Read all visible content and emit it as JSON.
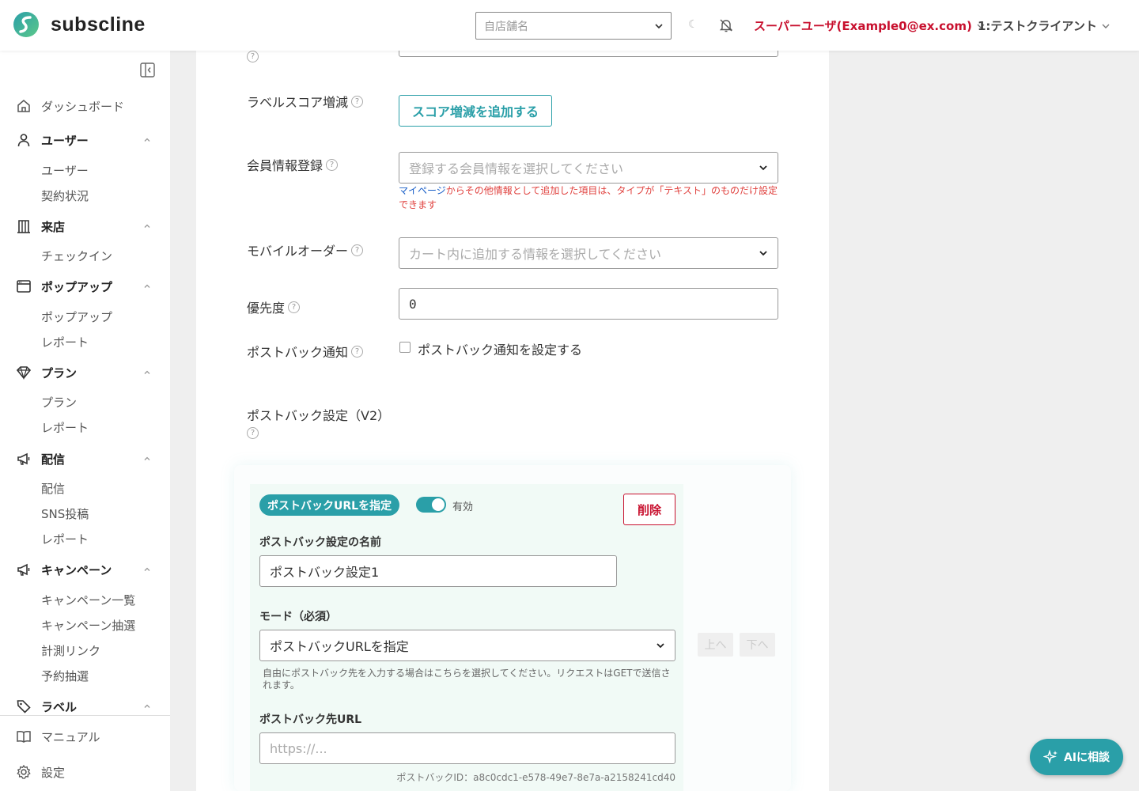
{
  "app": {
    "name": "subscline"
  },
  "header": {
    "store_placeholder": "自店舗名",
    "user": "スーパーユーザ(Example0@ex.com)",
    "client": "1:テストクライアント"
  },
  "sidebar": {
    "items": [
      {
        "label": "ダッシュボード"
      },
      {
        "label": "ユーザー",
        "children": [
          "ユーザー",
          "契約状況"
        ]
      },
      {
        "label": "来店",
        "children": [
          "チェックイン"
        ]
      },
      {
        "label": "ポップアップ",
        "children": [
          "ポップアップ",
          "レポート"
        ]
      },
      {
        "label": "プラン",
        "children": [
          "プラン",
          "レポート"
        ]
      },
      {
        "label": "配信",
        "children": [
          "配信",
          "SNS投稿",
          "レポート"
        ]
      },
      {
        "label": "キャンペーン",
        "children": [
          "キャンペーン一覧",
          "キャンペーン抽選",
          "計測リンク",
          "予約抽選"
        ]
      },
      {
        "label": "ラベル"
      }
    ],
    "bottom": [
      {
        "label": "マニュアル"
      },
      {
        "label": "設定"
      }
    ]
  },
  "form": {
    "label_score": {
      "label": "ラベルスコア増減",
      "button": "スコア増減を追加する"
    },
    "member_info": {
      "label": "会員情報登録",
      "placeholder": "登録する会員情報を選択してください",
      "note_link": "マイページ",
      "note_text": "からその他情報として追加した項目は、タイプが「テキスト」のものだけ設定できます"
    },
    "mobile_order": {
      "label": "モバイルオーダー",
      "placeholder": "カート内に追加する情報を選択してください"
    },
    "priority": {
      "label": "優先度",
      "value": "0"
    },
    "postback_notify": {
      "label": "ポストバック通知",
      "checkbox_label": "ポストバック通知を設定する"
    },
    "postback_v2": {
      "label": "ポストバック設定（V2）"
    }
  },
  "postback": {
    "tag": "ポストバックURLを指定",
    "enabled_label": "有効",
    "delete": "削除",
    "name_label": "ポストバック設定の名前",
    "name_value": "ポストバック設定1",
    "mode_label": "モード（必須）",
    "mode_value": "ポストバックURLを指定",
    "mode_help": "自由にポストバック先を入力する場合はこちらを選択してください。リクエストはGETで送信されます。",
    "url_label": "ポストバック先URL",
    "url_placeholder": "https://...",
    "id_text": "ポストバックID：a8c0cdc1-e578-49e7-8e7a-a2158241cd40",
    "up": "上へ",
    "down": "下へ"
  },
  "ai_button": "AIに相談",
  "colors": {
    "primary": "#2a9fa8",
    "danger": "#c8102e",
    "note": "#e0413e"
  }
}
